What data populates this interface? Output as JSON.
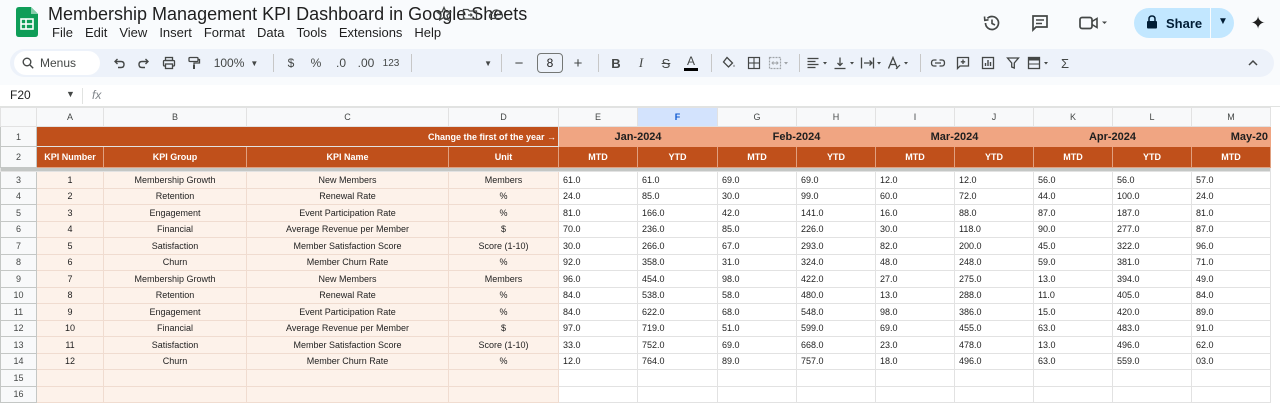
{
  "app": {
    "title": "Membership Management KPI Dashboard in Google Sheets",
    "menu": [
      "File",
      "Edit",
      "View",
      "Insert",
      "Format",
      "Data",
      "Tools",
      "Extensions",
      "Help"
    ],
    "share_label": "Share"
  },
  "toolbar": {
    "menus_label": "Menus",
    "zoom": "100%",
    "currency": "$",
    "percent": "%",
    "dec_decrease": ".0",
    "dec_increase": ".00",
    "number_format": "123",
    "font_size": "8"
  },
  "formula_bar": {
    "cell_ref": "F20",
    "fx": "fx"
  },
  "sheet": {
    "columns": [
      "A",
      "B",
      "C",
      "D",
      "E",
      "F",
      "G",
      "H",
      "I",
      "J",
      "K",
      "L",
      "M"
    ],
    "selected_column": "F",
    "row_numbers": [
      "1",
      "2",
      "3",
      "4",
      "5",
      "6",
      "7",
      "8",
      "9",
      "10",
      "11",
      "12",
      "13",
      "14",
      "15",
      "16"
    ],
    "banner": "Change the first of the year →",
    "months": [
      "Jan-2024",
      "Feb-2024",
      "Mar-2024",
      "Apr-2024",
      "May-20"
    ],
    "headers": [
      "KPI Number",
      "KPI Group",
      "KPI Name",
      "Unit"
    ],
    "sub_headers": [
      "MTD",
      "YTD",
      "MTD",
      "YTD",
      "MTD",
      "YTD",
      "MTD",
      "YTD",
      "MTD"
    ],
    "rows": [
      [
        "1",
        "Membership Growth",
        "New Members",
        "Members",
        "61.0",
        "61.0",
        "69.0",
        "69.0",
        "12.0",
        "12.0",
        "56.0",
        "56.0",
        "57.0"
      ],
      [
        "2",
        "Retention",
        "Renewal Rate",
        "%",
        "24.0",
        "85.0",
        "30.0",
        "99.0",
        "60.0",
        "72.0",
        "44.0",
        "100.0",
        "24.0"
      ],
      [
        "3",
        "Engagement",
        "Event Participation Rate",
        "%",
        "81.0",
        "166.0",
        "42.0",
        "141.0",
        "16.0",
        "88.0",
        "87.0",
        "187.0",
        "81.0"
      ],
      [
        "4",
        "Financial",
        "Average Revenue per Member",
        "$",
        "70.0",
        "236.0",
        "85.0",
        "226.0",
        "30.0",
        "118.0",
        "90.0",
        "277.0",
        "87.0"
      ],
      [
        "5",
        "Satisfaction",
        "Member Satisfaction Score",
        "Score (1-10)",
        "30.0",
        "266.0",
        "67.0",
        "293.0",
        "82.0",
        "200.0",
        "45.0",
        "322.0",
        "96.0"
      ],
      [
        "6",
        "Churn",
        "Member Churn Rate",
        "%",
        "92.0",
        "358.0",
        "31.0",
        "324.0",
        "48.0",
        "248.0",
        "59.0",
        "381.0",
        "71.0"
      ],
      [
        "7",
        "Membership Growth",
        "New Members",
        "Members",
        "96.0",
        "454.0",
        "98.0",
        "422.0",
        "27.0",
        "275.0",
        "13.0",
        "394.0",
        "49.0"
      ],
      [
        "8",
        "Retention",
        "Renewal Rate",
        "%",
        "84.0",
        "538.0",
        "58.0",
        "480.0",
        "13.0",
        "288.0",
        "11.0",
        "405.0",
        "84.0"
      ],
      [
        "9",
        "Engagement",
        "Event Participation Rate",
        "%",
        "84.0",
        "622.0",
        "68.0",
        "548.0",
        "98.0",
        "386.0",
        "15.0",
        "420.0",
        "89.0"
      ],
      [
        "10",
        "Financial",
        "Average Revenue per Member",
        "$",
        "97.0",
        "719.0",
        "51.0",
        "599.0",
        "69.0",
        "455.0",
        "63.0",
        "483.0",
        "91.0"
      ],
      [
        "11",
        "Satisfaction",
        "Member Satisfaction Score",
        "Score (1-10)",
        "33.0",
        "752.0",
        "69.0",
        "668.0",
        "23.0",
        "478.0",
        "13.0",
        "496.0",
        "62.0"
      ],
      [
        "12",
        "Churn",
        "Member Churn Rate",
        "%",
        "12.0",
        "764.0",
        "89.0",
        "757.0",
        "18.0",
        "496.0",
        "63.0",
        "559.0",
        "03.0"
      ]
    ]
  }
}
